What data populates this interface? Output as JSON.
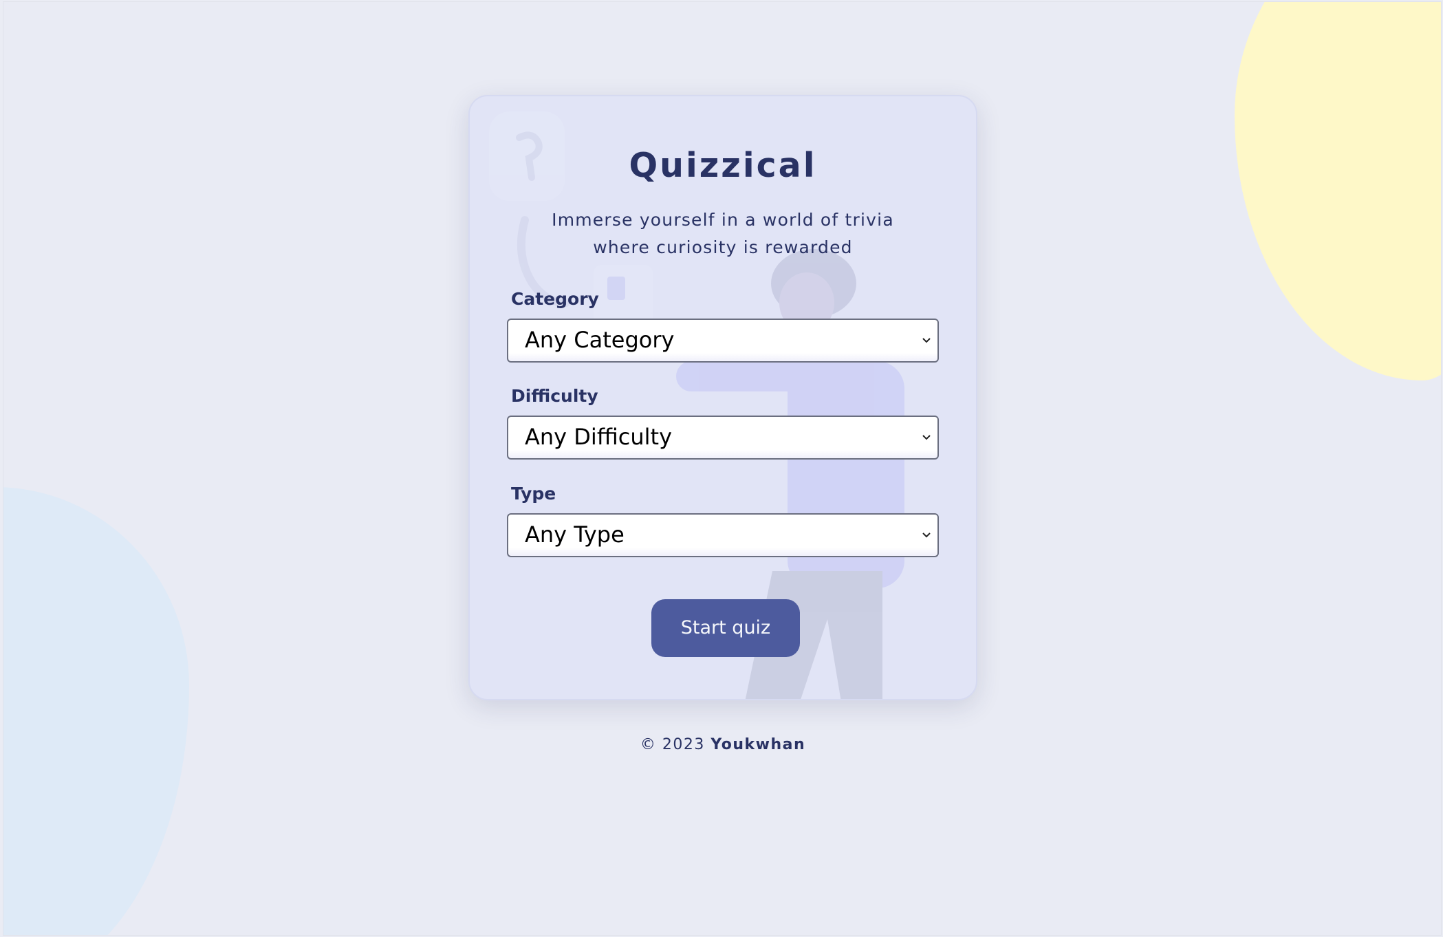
{
  "app": {
    "title": "Quizzical",
    "subtitle_line1": "Immerse yourself in a world of trivia",
    "subtitle_line2": "where curiosity is rewarded"
  },
  "form": {
    "category": {
      "label": "Category",
      "value": "Any Category"
    },
    "difficulty": {
      "label": "Difficulty",
      "value": "Any Difficulty"
    },
    "type": {
      "label": "Type",
      "value": "Any Type"
    },
    "start_button": "Start quiz"
  },
  "footer": {
    "copyright": "© 2023",
    "author": "Youkwhan"
  },
  "icons": {
    "select_arrow": "chevron-down-icon"
  },
  "colors": {
    "primary_text": "#293264",
    "button": "#4d5b9e",
    "background": "#e9ebf4",
    "blob_yellow": "#fef8c8",
    "blob_blue": "#deeaf7"
  }
}
